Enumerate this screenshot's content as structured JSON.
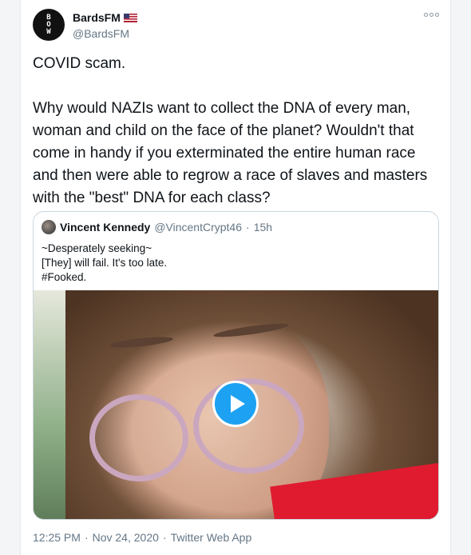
{
  "author": {
    "name": "BardsFM",
    "handle": "@BardsFM",
    "avatar_text": [
      "B",
      "O",
      "W"
    ],
    "flag_icon": "us-flag-icon"
  },
  "tweet": {
    "text": "COVID scam.\n\nWhy would NAZIs want to collect the DNA of every man, woman and child on the face of the planet? Wouldn't that come in handy if you exterminated the entire human race and then were able to regrow a race of slaves and masters with the \"best\" DNA for each class?"
  },
  "quoted": {
    "name": "Vincent Kennedy",
    "handle": "@VincentCrypt46",
    "dot": "·",
    "time": "15h",
    "lines": [
      "~Desperately seeking~",
      "[They] will fail. It's too late.",
      "#Fooked."
    ]
  },
  "footer": {
    "time": "12:25 PM",
    "dot1": "·",
    "date": "Nov 24, 2020",
    "dot2": "·",
    "app": "Twitter Web App"
  },
  "colors": {
    "accent": "#1da1f2",
    "secondary_text": "#657786",
    "scarf": "#e01b2f"
  }
}
